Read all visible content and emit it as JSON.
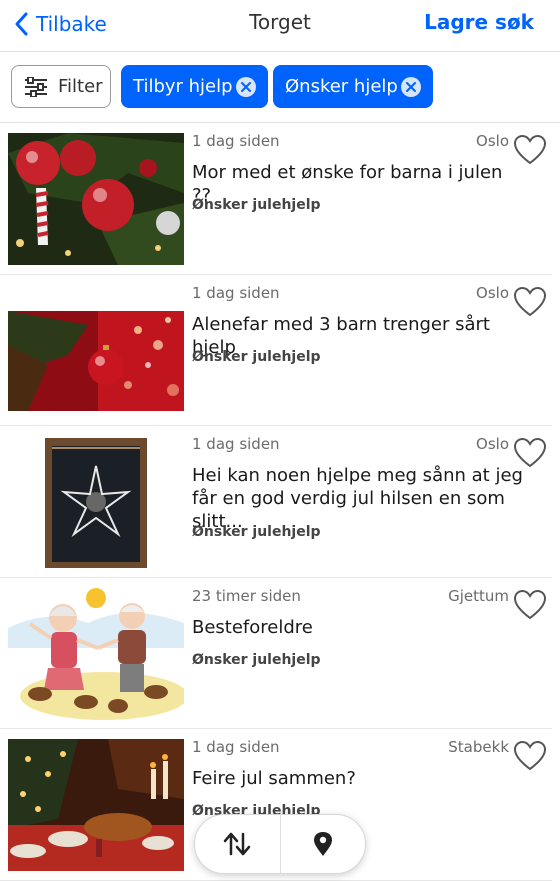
{
  "header": {
    "back_label": "Tilbake",
    "title": "Torget",
    "save_label": "Lagre søk"
  },
  "filters": {
    "filter_label": "Filter",
    "chips": [
      {
        "label": "Tilbyr hjelp"
      },
      {
        "label": "Ønsker hjelp"
      }
    ]
  },
  "listings": [
    {
      "time": "1 dag siden",
      "location": "Oslo",
      "title": "Mor med et ønske for barna i julen ??",
      "category": "Ønsker julehjelp",
      "image": "christmas-ornaments"
    },
    {
      "time": "1 dag siden",
      "location": "Oslo",
      "title": "Alenefar med 3 barn trenger sårt hjelp",
      "category": "Ønsker julehjelp",
      "image": "red-bauble"
    },
    {
      "time": "1 dag siden",
      "location": "Oslo",
      "title": "Hei kan  noen hjelpe meg sånn at jeg får en god verdig jul hilsen en som slitt...",
      "category": "Ønsker julehjelp",
      "image": "star-lamp"
    },
    {
      "time": "23 timer siden",
      "location": "Gjettum",
      "title": "Besteforeldre",
      "category": "Ønsker julehjelp",
      "image": "grandparents-cartoon"
    },
    {
      "time": "1 dag siden",
      "location": "Stabekk",
      "title": "Feire jul sammen?",
      "category": "Ønsker julehjelp",
      "image": "christmas-dinner"
    }
  ],
  "colors": {
    "accent": "#0063fb"
  },
  "fab": {
    "sort_icon": "sort-arrows-icon",
    "map_icon": "map-pin-icon"
  }
}
